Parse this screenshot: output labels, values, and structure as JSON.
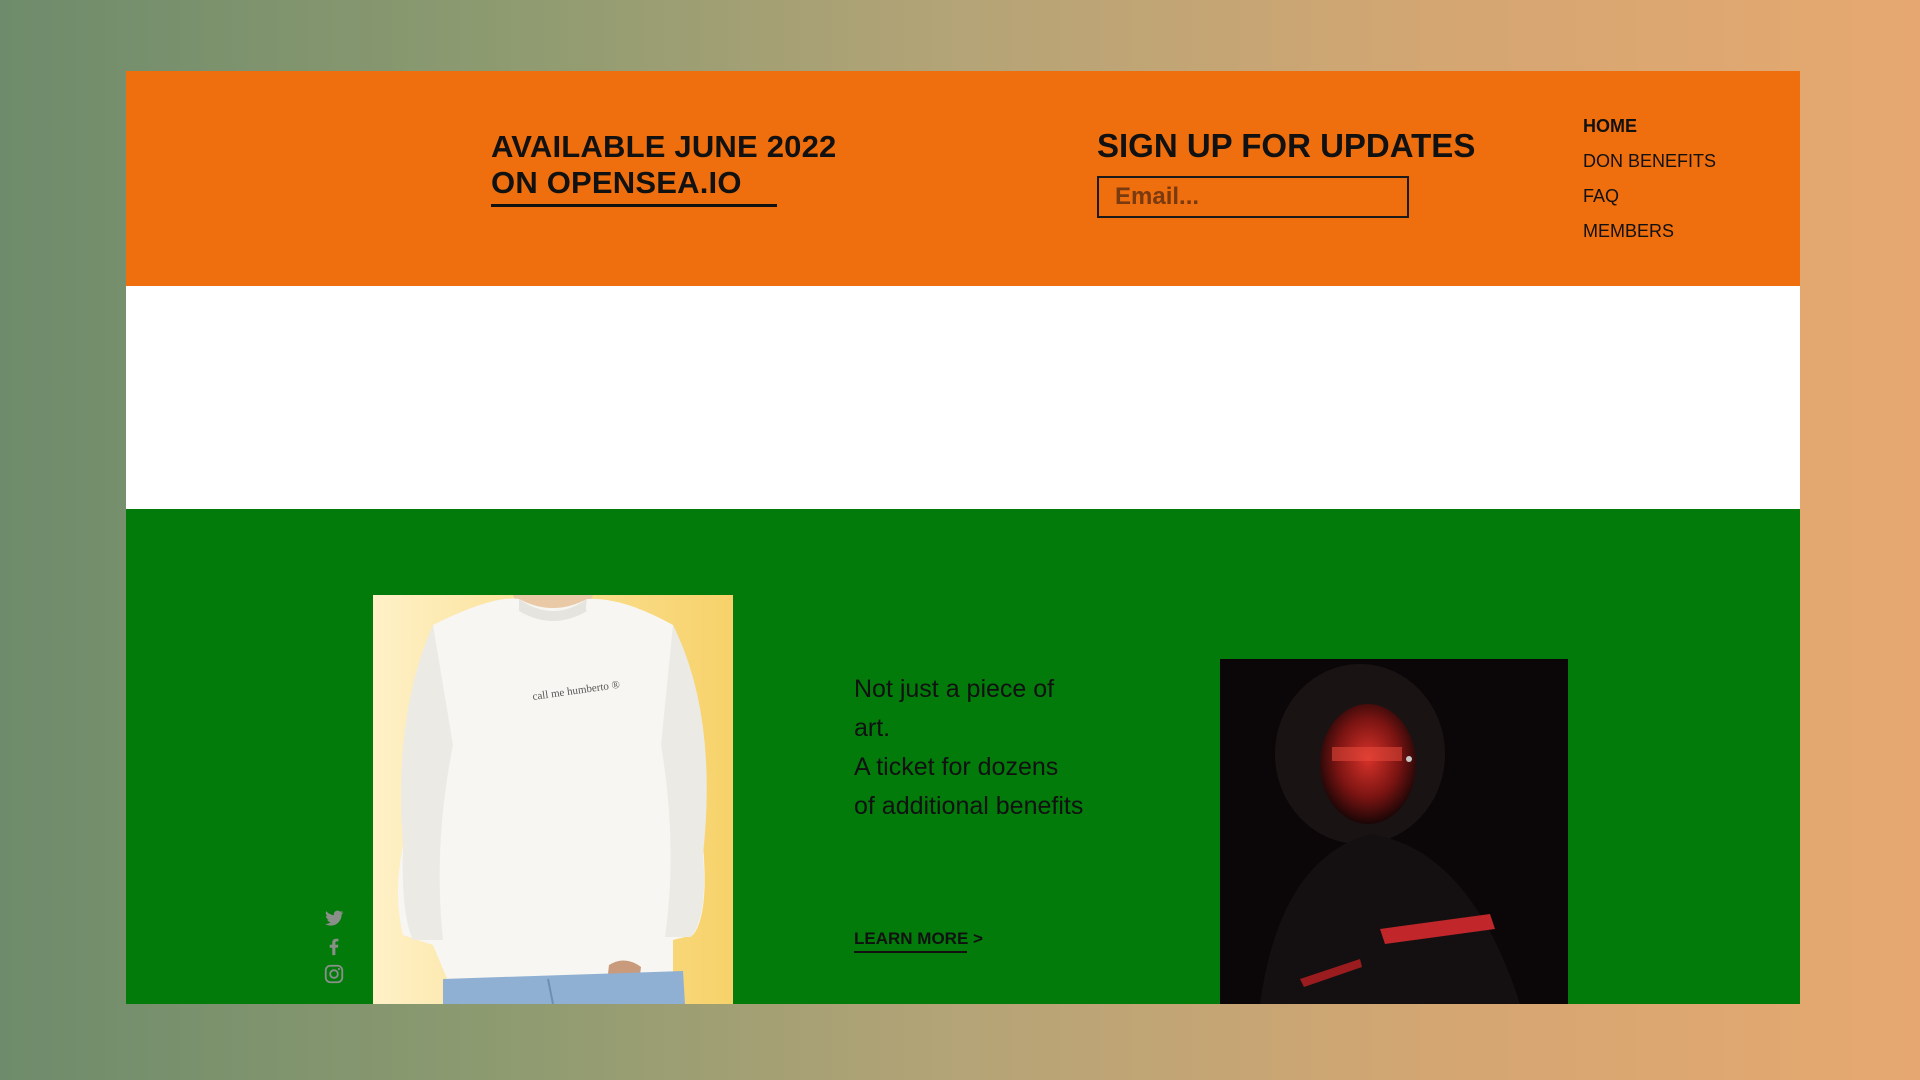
{
  "header": {
    "availability_line1": "AVAILABLE JUNE 2022",
    "availability_line2": "ON OPENSEA.IO",
    "signup_title": "SIGN UP FOR UPDATES",
    "email_placeholder": "Email..."
  },
  "nav": {
    "items": [
      {
        "label": "HOME",
        "active": true
      },
      {
        "label": "DON BENEFITS",
        "active": false
      },
      {
        "label": "FAQ",
        "active": false
      },
      {
        "label": "MEMBERS",
        "active": false
      }
    ]
  },
  "main": {
    "blurb": "Not just a piece of art.\nA ticket for dozens of additional benefits",
    "blurb_line1": "Not just a piece of art.",
    "blurb_line2": "A ticket for dozens of additional benefits",
    "learn_more": "LEARN MORE >",
    "sweatshirt_print": "call me humberto ®"
  },
  "social": {
    "icons": [
      "twitter-icon",
      "facebook-icon",
      "instagram-icon"
    ]
  },
  "colors": {
    "header_orange": "#ef6e0e",
    "section_green": "#027b0a",
    "band_white": "#ffffff",
    "text_dark": "#111111",
    "social_icon_gray": "#8a8f8a"
  }
}
